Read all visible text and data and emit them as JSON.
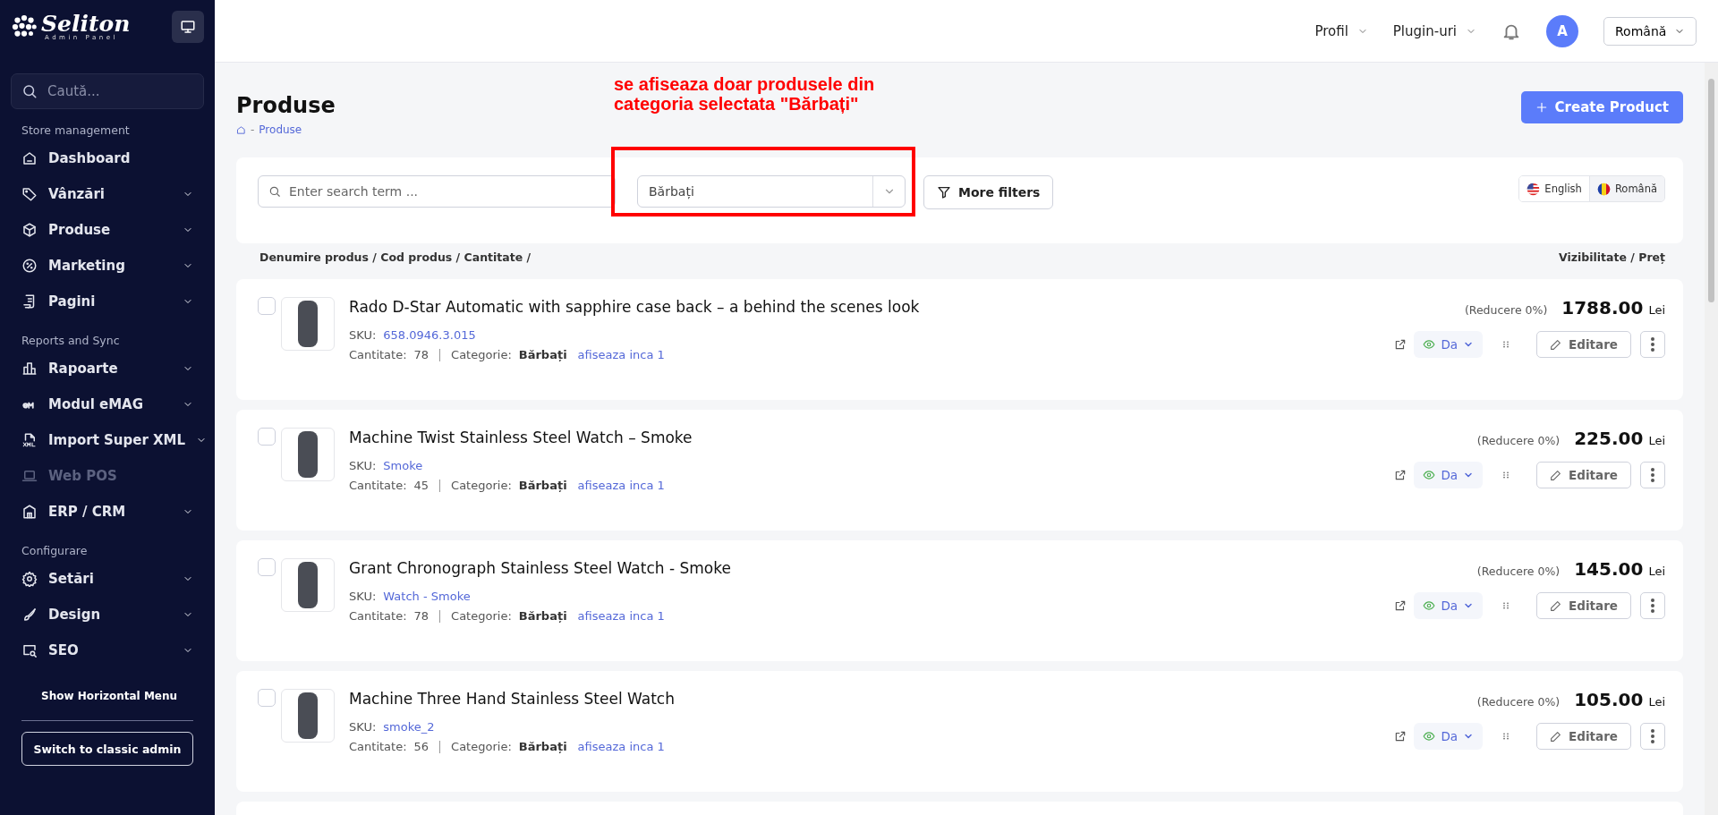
{
  "sidebar": {
    "logo": {
      "name": "Seliton",
      "subtitle": "Admin Panel"
    },
    "search": {
      "placeholder": "Caută..."
    },
    "sections": [
      {
        "title": "Store management",
        "items": [
          {
            "label": "Dashboard",
            "expandable": false,
            "disabled": false
          },
          {
            "label": "Vânzări",
            "expandable": true,
            "disabled": false
          },
          {
            "label": "Produse",
            "expandable": true,
            "disabled": false
          },
          {
            "label": "Marketing",
            "expandable": true,
            "disabled": false
          },
          {
            "label": "Pagini",
            "expandable": true,
            "disabled": false
          }
        ]
      },
      {
        "title": "Reports and Sync",
        "items": [
          {
            "label": "Rapoarte",
            "expandable": true,
            "disabled": false
          },
          {
            "label": "Modul eMAG",
            "expandable": true,
            "disabled": false
          },
          {
            "label": "Import Super XML",
            "expandable": true,
            "disabled": false
          },
          {
            "label": "Web POS",
            "expandable": false,
            "disabled": true
          },
          {
            "label": "ERP / CRM",
            "expandable": true,
            "disabled": false
          }
        ]
      },
      {
        "title": "Configurare",
        "items": [
          {
            "label": "Setări",
            "expandable": true,
            "disabled": false
          },
          {
            "label": "Design",
            "expandable": true,
            "disabled": false
          },
          {
            "label": "SEO",
            "expandable": true,
            "disabled": false
          }
        ]
      }
    ],
    "horizontal_menu": "Show Horizontal Menu",
    "classic_button": "Switch to classic admin"
  },
  "header": {
    "menus": [
      "Profil",
      "Plugin-uri"
    ],
    "avatar": "A",
    "language": "Română"
  },
  "page": {
    "title": "Produse",
    "breadcrumb_separator": "-",
    "breadcrumb": "Produse",
    "create_button": "Create Product"
  },
  "annotation": {
    "text": "se afiseaza doar produsele din categoria selectata \"Bărbați\""
  },
  "filters": {
    "search_placeholder": "Enter search term ...",
    "category": "Bărbați",
    "more_filters": "More filters",
    "languages": [
      {
        "label": "English",
        "selected": false
      },
      {
        "label": "Română",
        "selected": true
      }
    ]
  },
  "columns": {
    "left": "Denumire produs / Cod produs / Cantitate /",
    "right": "Vizibilitate / Preț"
  },
  "products": [
    {
      "name": "Rado D-Star Automatic with sapphire case back – a behind the scenes look",
      "sku_label": "SKU:",
      "sku": "658.0946.3.015",
      "quantity_label": "Cantitate:",
      "quantity": "78",
      "category_label": "Categorie:",
      "category": "Bărbați",
      "more": "afiseaza inca 1",
      "discount": "(Reducere 0%)",
      "price": "1788.00",
      "currency": "Lei",
      "visibility": "Da",
      "edit": "Editare",
      "checked": false
    },
    {
      "name": "Machine Twist Stainless Steel Watch – Smoke",
      "sku_label": "SKU:",
      "sku": "Smoke",
      "quantity_label": "Cantitate:",
      "quantity": "45",
      "category_label": "Categorie:",
      "category": "Bărbați",
      "more": "afiseaza inca 1",
      "discount": "(Reducere 0%)",
      "price": "225.00",
      "currency": "Lei",
      "visibility": "Da",
      "edit": "Editare",
      "checked": false
    },
    {
      "name": "Grant Chronograph Stainless Steel Watch - Smoke",
      "sku_label": "SKU:",
      "sku": "Watch - Smoke",
      "quantity_label": "Cantitate:",
      "quantity": "78",
      "category_label": "Categorie:",
      "category": "Bărbați",
      "more": "afiseaza inca 1",
      "discount": "(Reducere 0%)",
      "price": "145.00",
      "currency": "Lei",
      "visibility": "Da",
      "edit": "Editare",
      "checked": false
    },
    {
      "name": "Machine Three Hand Stainless Steel Watch",
      "sku_label": "SKU:",
      "sku": "smoke_2",
      "quantity_label": "Cantitate:",
      "quantity": "56",
      "category_label": "Categorie:",
      "category": "Bărbați",
      "more": "afiseaza inca 1",
      "discount": "(Reducere 0%)",
      "price": "105.00",
      "currency": "Lei",
      "visibility": "Da",
      "edit": "Editare",
      "checked": false
    }
  ]
}
